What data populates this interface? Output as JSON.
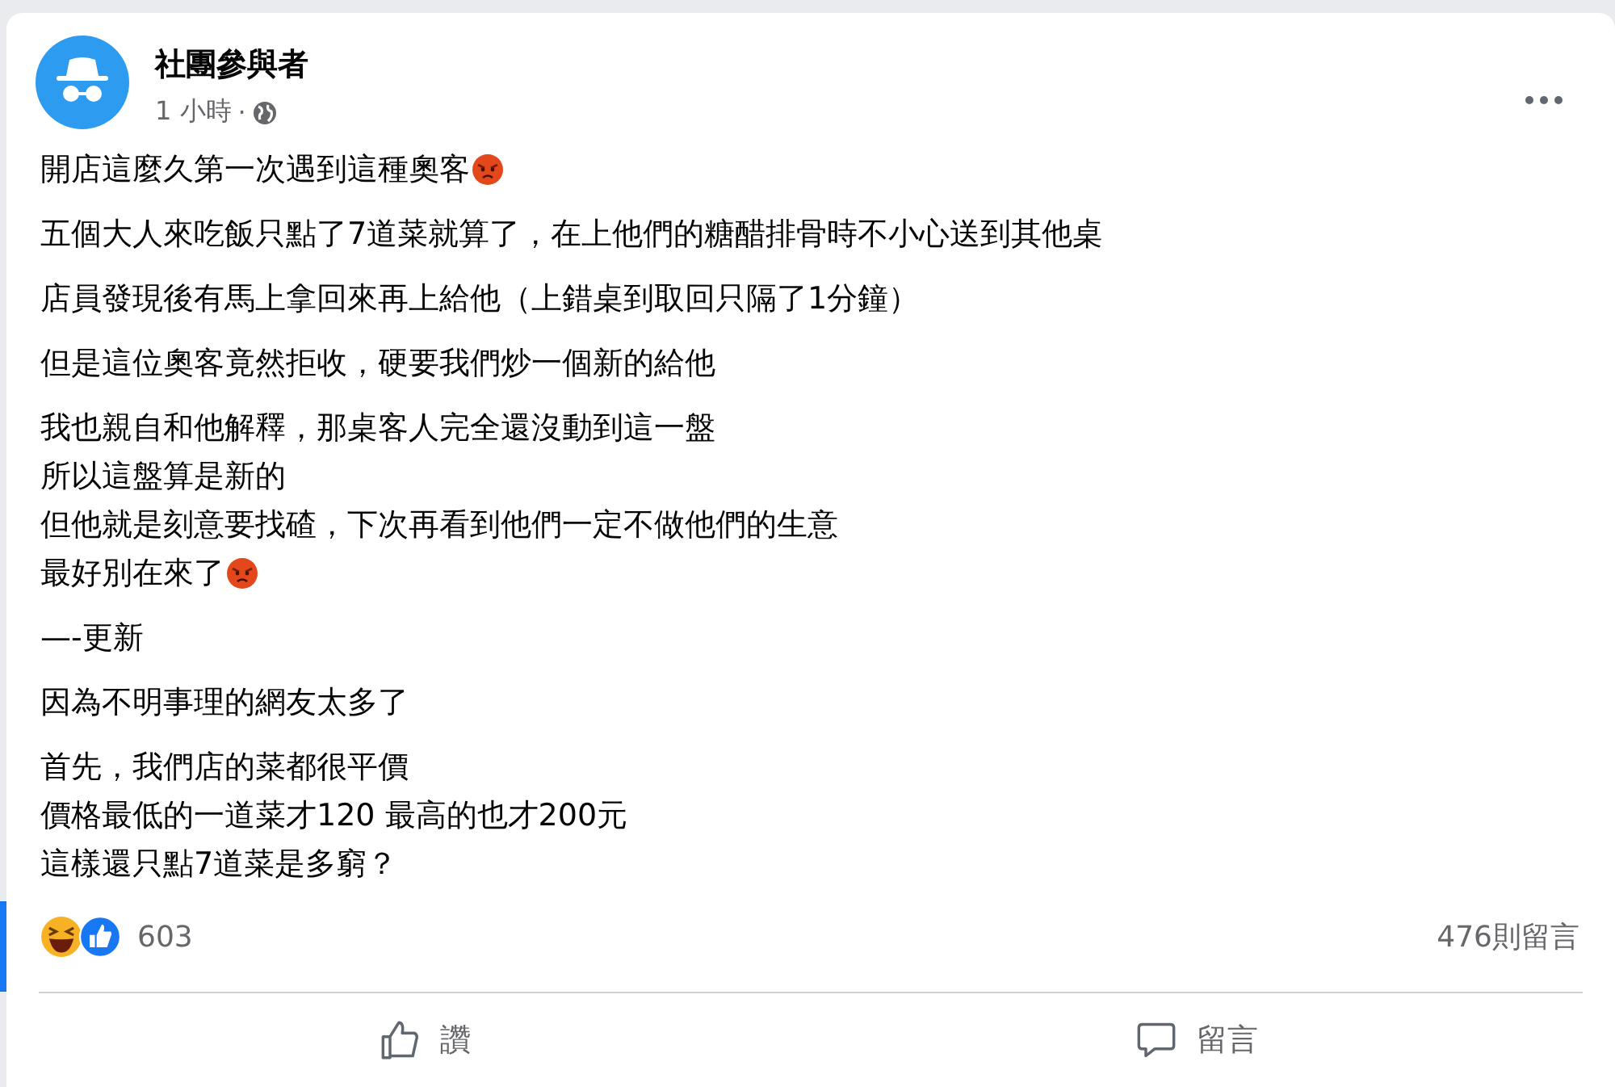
{
  "post": {
    "author": "社團參與者",
    "time": "1 小時",
    "separator": "·"
  },
  "paragraphs": [
    [
      {
        "text": "開店這麼久第一次遇到這種奧客",
        "angry_emoji": true
      }
    ],
    [
      {
        "text": "五個大人來吃飯只點了7道菜就算了，在上他們的糖醋排骨時不小心送到其他桌",
        "angry_emoji": false
      }
    ],
    [
      {
        "text": "店員發現後有馬上拿回來再上給他（上錯桌到取回只隔了1分鐘）",
        "angry_emoji": false
      }
    ],
    [
      {
        "text": "但是這位奧客竟然拒收，硬要我們炒一個新的給他",
        "angry_emoji": false
      }
    ],
    [
      {
        "text": "我也親自和他解釋，那桌客人完全還沒動到這一盤",
        "angry_emoji": false
      },
      {
        "text": "所以這盤算是新的",
        "angry_emoji": false
      },
      {
        "text": "但他就是刻意要找碴，下次再看到他們一定不做他們的生意",
        "angry_emoji": false
      },
      {
        "text": "最好別在來了",
        "angry_emoji": true
      }
    ],
    [
      {
        "text": "—-更新",
        "angry_emoji": false
      }
    ],
    [
      {
        "text": "因為不明事理的網友太多了",
        "angry_emoji": false
      }
    ],
    [
      {
        "text": "首先，我們店的菜都很平價",
        "angry_emoji": false
      },
      {
        "text": "價格最低的一道菜才120 最高的也才200元",
        "angry_emoji": false
      },
      {
        "text": "這樣還只點7道菜是多窮？",
        "angry_emoji": false
      }
    ]
  ],
  "reactions": {
    "count": "603",
    "comments": "476則留言"
  },
  "actions": [
    {
      "kind": "like",
      "label": "讚"
    },
    {
      "kind": "comment",
      "label": "留言"
    }
  ]
}
